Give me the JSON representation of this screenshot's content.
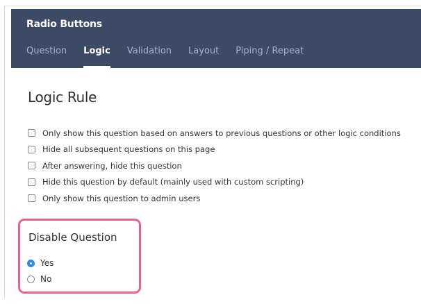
{
  "header": {
    "title": "Radio Buttons",
    "tabs": [
      {
        "label": "Question",
        "active": false
      },
      {
        "label": "Logic",
        "active": true
      },
      {
        "label": "Validation",
        "active": false
      },
      {
        "label": "Layout",
        "active": false
      },
      {
        "label": "Piping / Repeat",
        "active": false
      }
    ]
  },
  "logic": {
    "title": "Logic Rule",
    "options": [
      {
        "label": "Only show this question based on answers to previous questions or other logic conditions",
        "checked": false
      },
      {
        "label": "Hide all subsequent questions on this page",
        "checked": false
      },
      {
        "label": "After answering, hide this question",
        "checked": false
      },
      {
        "label": "Hide this question by default (mainly used with custom scripting)",
        "checked": false
      },
      {
        "label": "Only show this question to admin users",
        "checked": false
      }
    ]
  },
  "disable_question": {
    "title": "Disable Question",
    "options": [
      {
        "label": "Yes",
        "selected": true
      },
      {
        "label": "No",
        "selected": false
      }
    ]
  },
  "colors": {
    "header_bg": "#3d4a66",
    "highlight_border": "#e8638a",
    "radio_selected": "#2f8be0"
  }
}
